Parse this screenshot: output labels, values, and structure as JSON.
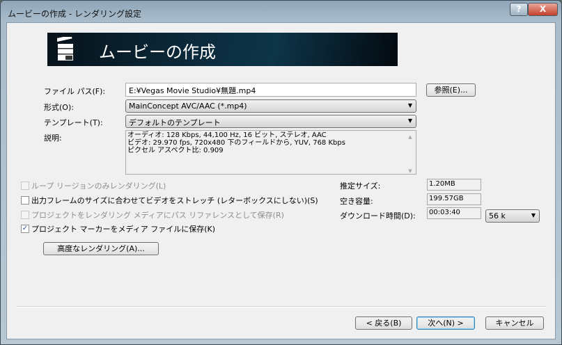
{
  "window": {
    "title": "ムービーの作成 - レンダリング設定",
    "help_label": "?",
    "close_label": "X"
  },
  "banner": {
    "title": "ムービーの作成",
    "icon": "clapperboard-hd-icon"
  },
  "form": {
    "file_path_label": "ファイル パス(F):",
    "file_path_value": "E:¥Vegas Movie Studio¥無題.mp4",
    "browse_label": "参照(E)...",
    "format_label": "形式(O):",
    "format_value": "MainConcept AVC/AAC (*.mp4)",
    "template_label": "テンプレート(T):",
    "template_value": "デフォルトのテンプレート",
    "description_label": "説明:",
    "description_lines": [
      "オーディオ: 128 Kbps, 44,100 Hz, 16 ビット, ステレオ, AAC",
      "ビデオ: 29.970 fps, 720x480 下のフィールドから, YUV, 768 Kbps",
      "ピクセル アスペクト比: 0.909"
    ]
  },
  "options": [
    {
      "label": "ループ リージョンのみレンダリング(L)",
      "checked": false,
      "enabled": false
    },
    {
      "label": "出力フレームのサイズに合わせてビデオをストレッチ (レターボックスにしない)(S)",
      "checked": false,
      "enabled": true
    },
    {
      "label": "プロジェクトをレンダリング メディアにパス リファレンスとして保存(R)",
      "checked": false,
      "enabled": false
    },
    {
      "label": "プロジェクト マーカーをメディア ファイルに保存(K)",
      "checked": true,
      "enabled": true
    }
  ],
  "stats": {
    "est_size_label": "推定サイズ:",
    "est_size_value": "1.20MB",
    "free_space_label": "空き容量:",
    "free_space_value": "199.57GB",
    "download_label": "ダウンロード時間(D):",
    "download_value": "00:03:40",
    "speed_value": "56 k"
  },
  "advanced_label": "高度なレンダリング(A)...",
  "footer": {
    "back_label": "< 戻る(B)",
    "next_label": "次へ(N) >",
    "cancel_label": "キャンセル"
  }
}
